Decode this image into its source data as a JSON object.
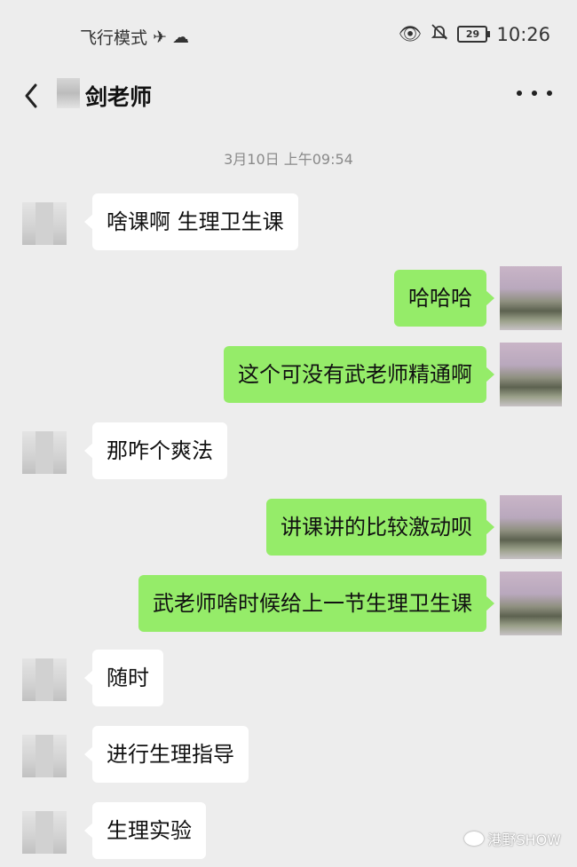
{
  "status_bar": {
    "left_text": "飞行模式",
    "time": "10:26",
    "battery": "29"
  },
  "nav": {
    "title": "剑老师"
  },
  "timestamp": "3月10日 上午09:54",
  "messages": [
    {
      "side": "left",
      "text": "啥课啊 生理卫生课"
    },
    {
      "side": "right",
      "text": "哈哈哈"
    },
    {
      "side": "right",
      "text": "这个可没有武老师精通啊"
    },
    {
      "side": "left",
      "text": "那咋个爽法"
    },
    {
      "side": "right",
      "text": "讲课讲的比较激动呗"
    },
    {
      "side": "right",
      "text": "武老师啥时候给上一节生理卫生课"
    },
    {
      "side": "left",
      "text": "随时"
    },
    {
      "side": "left",
      "text": "进行生理指导"
    },
    {
      "side": "left",
      "text": "生理实验"
    }
  ],
  "watermark": "港野SHOW",
  "colors": {
    "background": "#ededed",
    "bubble_left": "#ffffff",
    "bubble_right": "#95ec69"
  }
}
